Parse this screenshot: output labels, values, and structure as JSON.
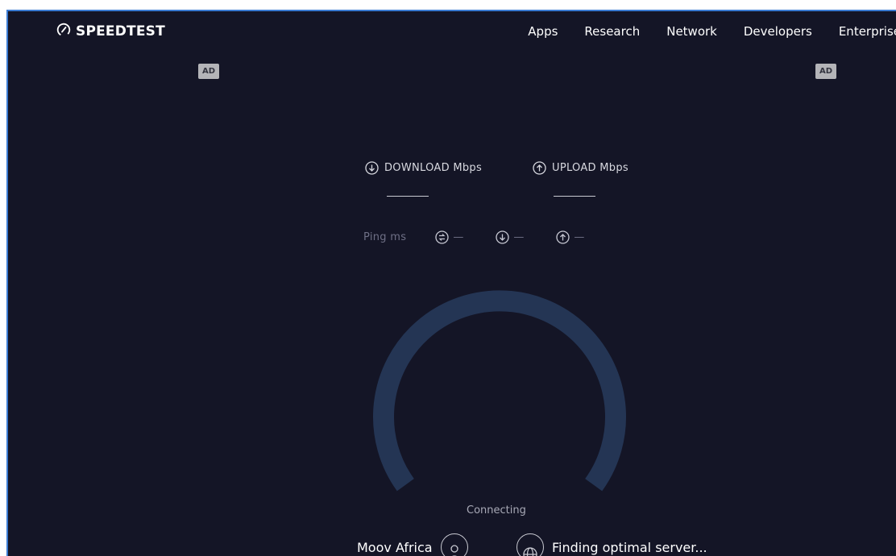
{
  "header": {
    "logo_text": "SPEEDTEST",
    "nav": [
      "Apps",
      "Research",
      "Network",
      "Developers",
      "Enterprise"
    ]
  },
  "ads": {
    "left": "AD",
    "right": "AD"
  },
  "metrics": {
    "download_label": "DOWNLOAD Mbps",
    "upload_label": "UPLOAD Mbps"
  },
  "ping": {
    "label": "Ping ms",
    "idle": "—",
    "download": "—",
    "upload": "—"
  },
  "status": "Connecting",
  "provider": {
    "isp": "Moov Africa",
    "server": "Finding optimal server..."
  },
  "colors": {
    "background": "#141526",
    "gauge_track": "#243554",
    "text": "#ffffff",
    "muted": "#6f7086"
  },
  "icons": {
    "logo": "speedometer-icon",
    "download": "arrow-down-circle-icon",
    "upload": "arrow-up-circle-icon",
    "idle_ping": "exchange-circle-icon",
    "isp": "user-icon",
    "server": "globe-icon"
  }
}
